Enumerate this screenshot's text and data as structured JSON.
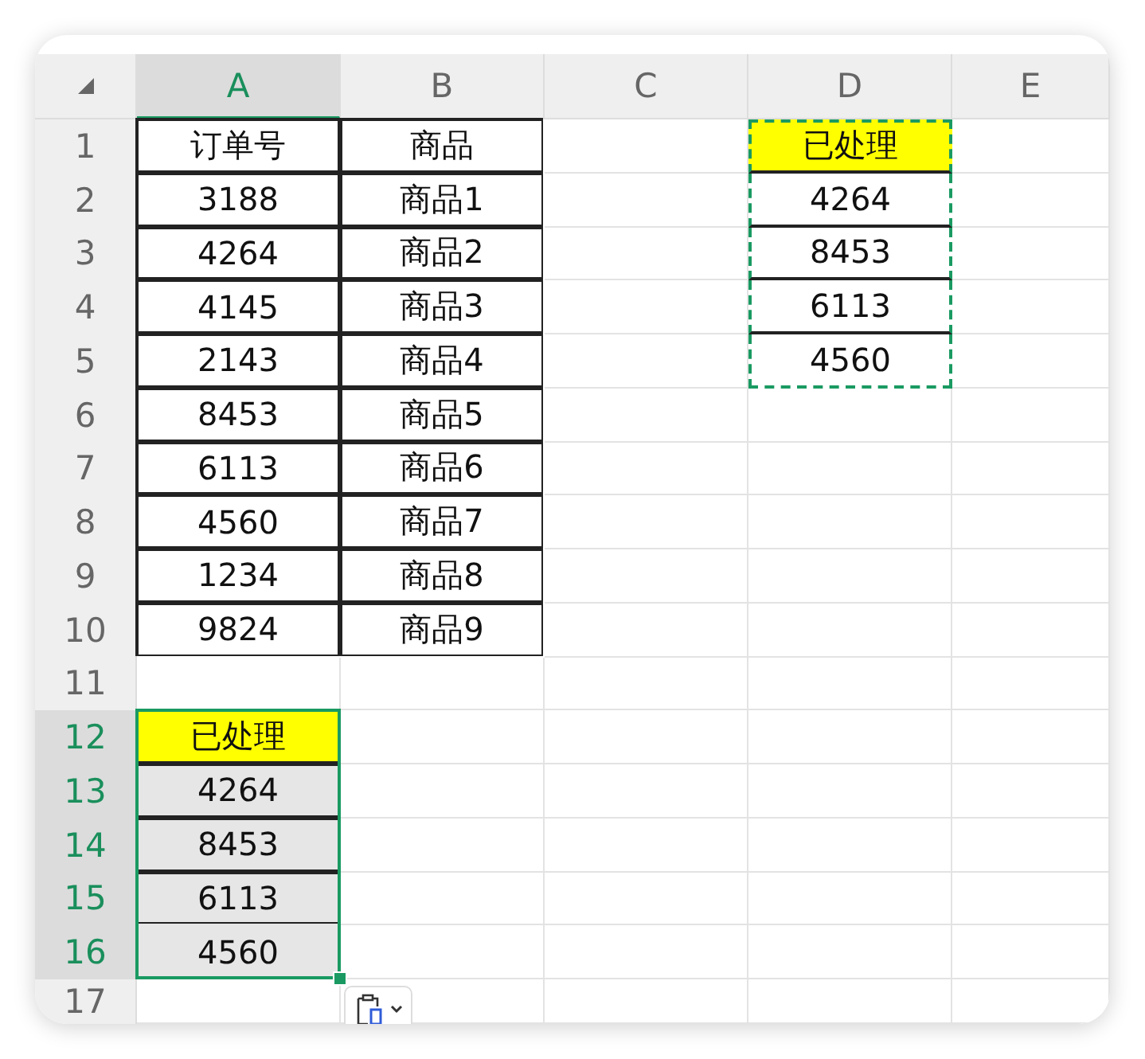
{
  "corner": {
    "kind": "select-all"
  },
  "columns": [
    {
      "label": "A",
      "selected": true
    },
    {
      "label": "B",
      "selected": false
    },
    {
      "label": "C",
      "selected": false
    },
    {
      "label": "D",
      "selected": false
    },
    {
      "label": "E",
      "selected": false
    }
  ],
  "rows": [
    {
      "label": "1",
      "selected": false,
      "cells": [
        {
          "text": "订单号",
          "bordered": true
        },
        {
          "text": "商品",
          "bordered": true
        },
        {},
        {
          "text": "已处理",
          "bordered": true,
          "highlighted": true,
          "copied": true
        },
        {}
      ]
    },
    {
      "label": "2",
      "selected": false,
      "cells": [
        {
          "text": "3188",
          "bordered": true
        },
        {
          "text": "商品1",
          "bordered": true
        },
        {},
        {
          "text": "4264",
          "bordered": true,
          "copied": true
        },
        {}
      ]
    },
    {
      "label": "3",
      "selected": false,
      "cells": [
        {
          "text": "4264",
          "bordered": true
        },
        {
          "text": "商品2",
          "bordered": true
        },
        {},
        {
          "text": "8453",
          "bordered": true,
          "copied": true
        },
        {}
      ]
    },
    {
      "label": "4",
      "selected": false,
      "cells": [
        {
          "text": "4145",
          "bordered": true
        },
        {
          "text": "商品3",
          "bordered": true
        },
        {},
        {
          "text": "6113",
          "bordered": true,
          "copied": true
        },
        {}
      ]
    },
    {
      "label": "5",
      "selected": false,
      "cells": [
        {
          "text": "2143",
          "bordered": true
        },
        {
          "text": "商品4",
          "bordered": true
        },
        {},
        {
          "text": "4560",
          "bordered": true,
          "copied": true
        },
        {}
      ]
    },
    {
      "label": "6",
      "selected": false,
      "cells": [
        {
          "text": "8453",
          "bordered": true
        },
        {
          "text": "商品5",
          "bordered": true
        },
        {},
        {},
        {}
      ]
    },
    {
      "label": "7",
      "selected": false,
      "cells": [
        {
          "text": "6113",
          "bordered": true
        },
        {
          "text": "商品6",
          "bordered": true
        },
        {},
        {},
        {}
      ]
    },
    {
      "label": "8",
      "selected": false,
      "cells": [
        {
          "text": "4560",
          "bordered": true
        },
        {
          "text": "商品7",
          "bordered": true
        },
        {},
        {},
        {}
      ]
    },
    {
      "label": "9",
      "selected": false,
      "cells": [
        {
          "text": "1234",
          "bordered": true
        },
        {
          "text": "商品8",
          "bordered": true
        },
        {},
        {},
        {}
      ]
    },
    {
      "label": "10",
      "selected": false,
      "cells": [
        {
          "text": "9824",
          "bordered": true
        },
        {
          "text": "商品9",
          "bordered": true
        },
        {},
        {},
        {}
      ]
    },
    {
      "label": "11",
      "selected": false,
      "cells": [
        {},
        {},
        {},
        {},
        {}
      ]
    },
    {
      "label": "12",
      "selected": true,
      "cells": [
        {
          "text": "已处理",
          "bordered": true,
          "highlighted": true,
          "selected": true
        },
        {},
        {},
        {},
        {}
      ]
    },
    {
      "label": "13",
      "selected": true,
      "cells": [
        {
          "text": "4264",
          "bordered": true,
          "selected": true
        },
        {},
        {},
        {},
        {}
      ]
    },
    {
      "label": "14",
      "selected": true,
      "cells": [
        {
          "text": "8453",
          "bordered": true,
          "selected": true
        },
        {},
        {},
        {},
        {}
      ]
    },
    {
      "label": "15",
      "selected": true,
      "cells": [
        {
          "text": "6113",
          "bordered": true,
          "selected": true
        },
        {},
        {},
        {},
        {}
      ]
    },
    {
      "label": "16",
      "selected": true,
      "cells": [
        {
          "text": "4560",
          "selected": true
        },
        {},
        {},
        {},
        {}
      ]
    },
    {
      "label": "17",
      "selected": false,
      "cells": [
        {},
        {},
        {},
        {},
        {}
      ]
    }
  ],
  "paste_options": {
    "kind": "paste"
  }
}
